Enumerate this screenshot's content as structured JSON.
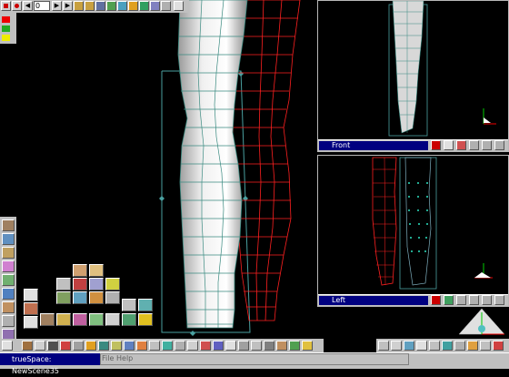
{
  "top_toolbar": {
    "frame_value": "0",
    "icons": [
      "stop-icon",
      "record-icon",
      "rewind-icon",
      "play-icon",
      "step-icon",
      "keyframe-icon",
      "loop-icon",
      "grid-icon",
      "link-icon",
      "render-icon",
      "material-icon",
      "paint-icon",
      "note-icon"
    ]
  },
  "viewports": {
    "front": {
      "title": "Front"
    },
    "left": {
      "title": "Left"
    }
  },
  "status": {
    "app_title": "trueSpace: NewScene35",
    "menu_file": "File",
    "menu_help": "Help"
  },
  "colors": {
    "toolbar_bg": "#c0c0c0",
    "titlebar": "#000080",
    "mesh_selected": "#ff2020",
    "mesh_wire": "#3a8a80",
    "bbox": "#4aa0a0"
  }
}
